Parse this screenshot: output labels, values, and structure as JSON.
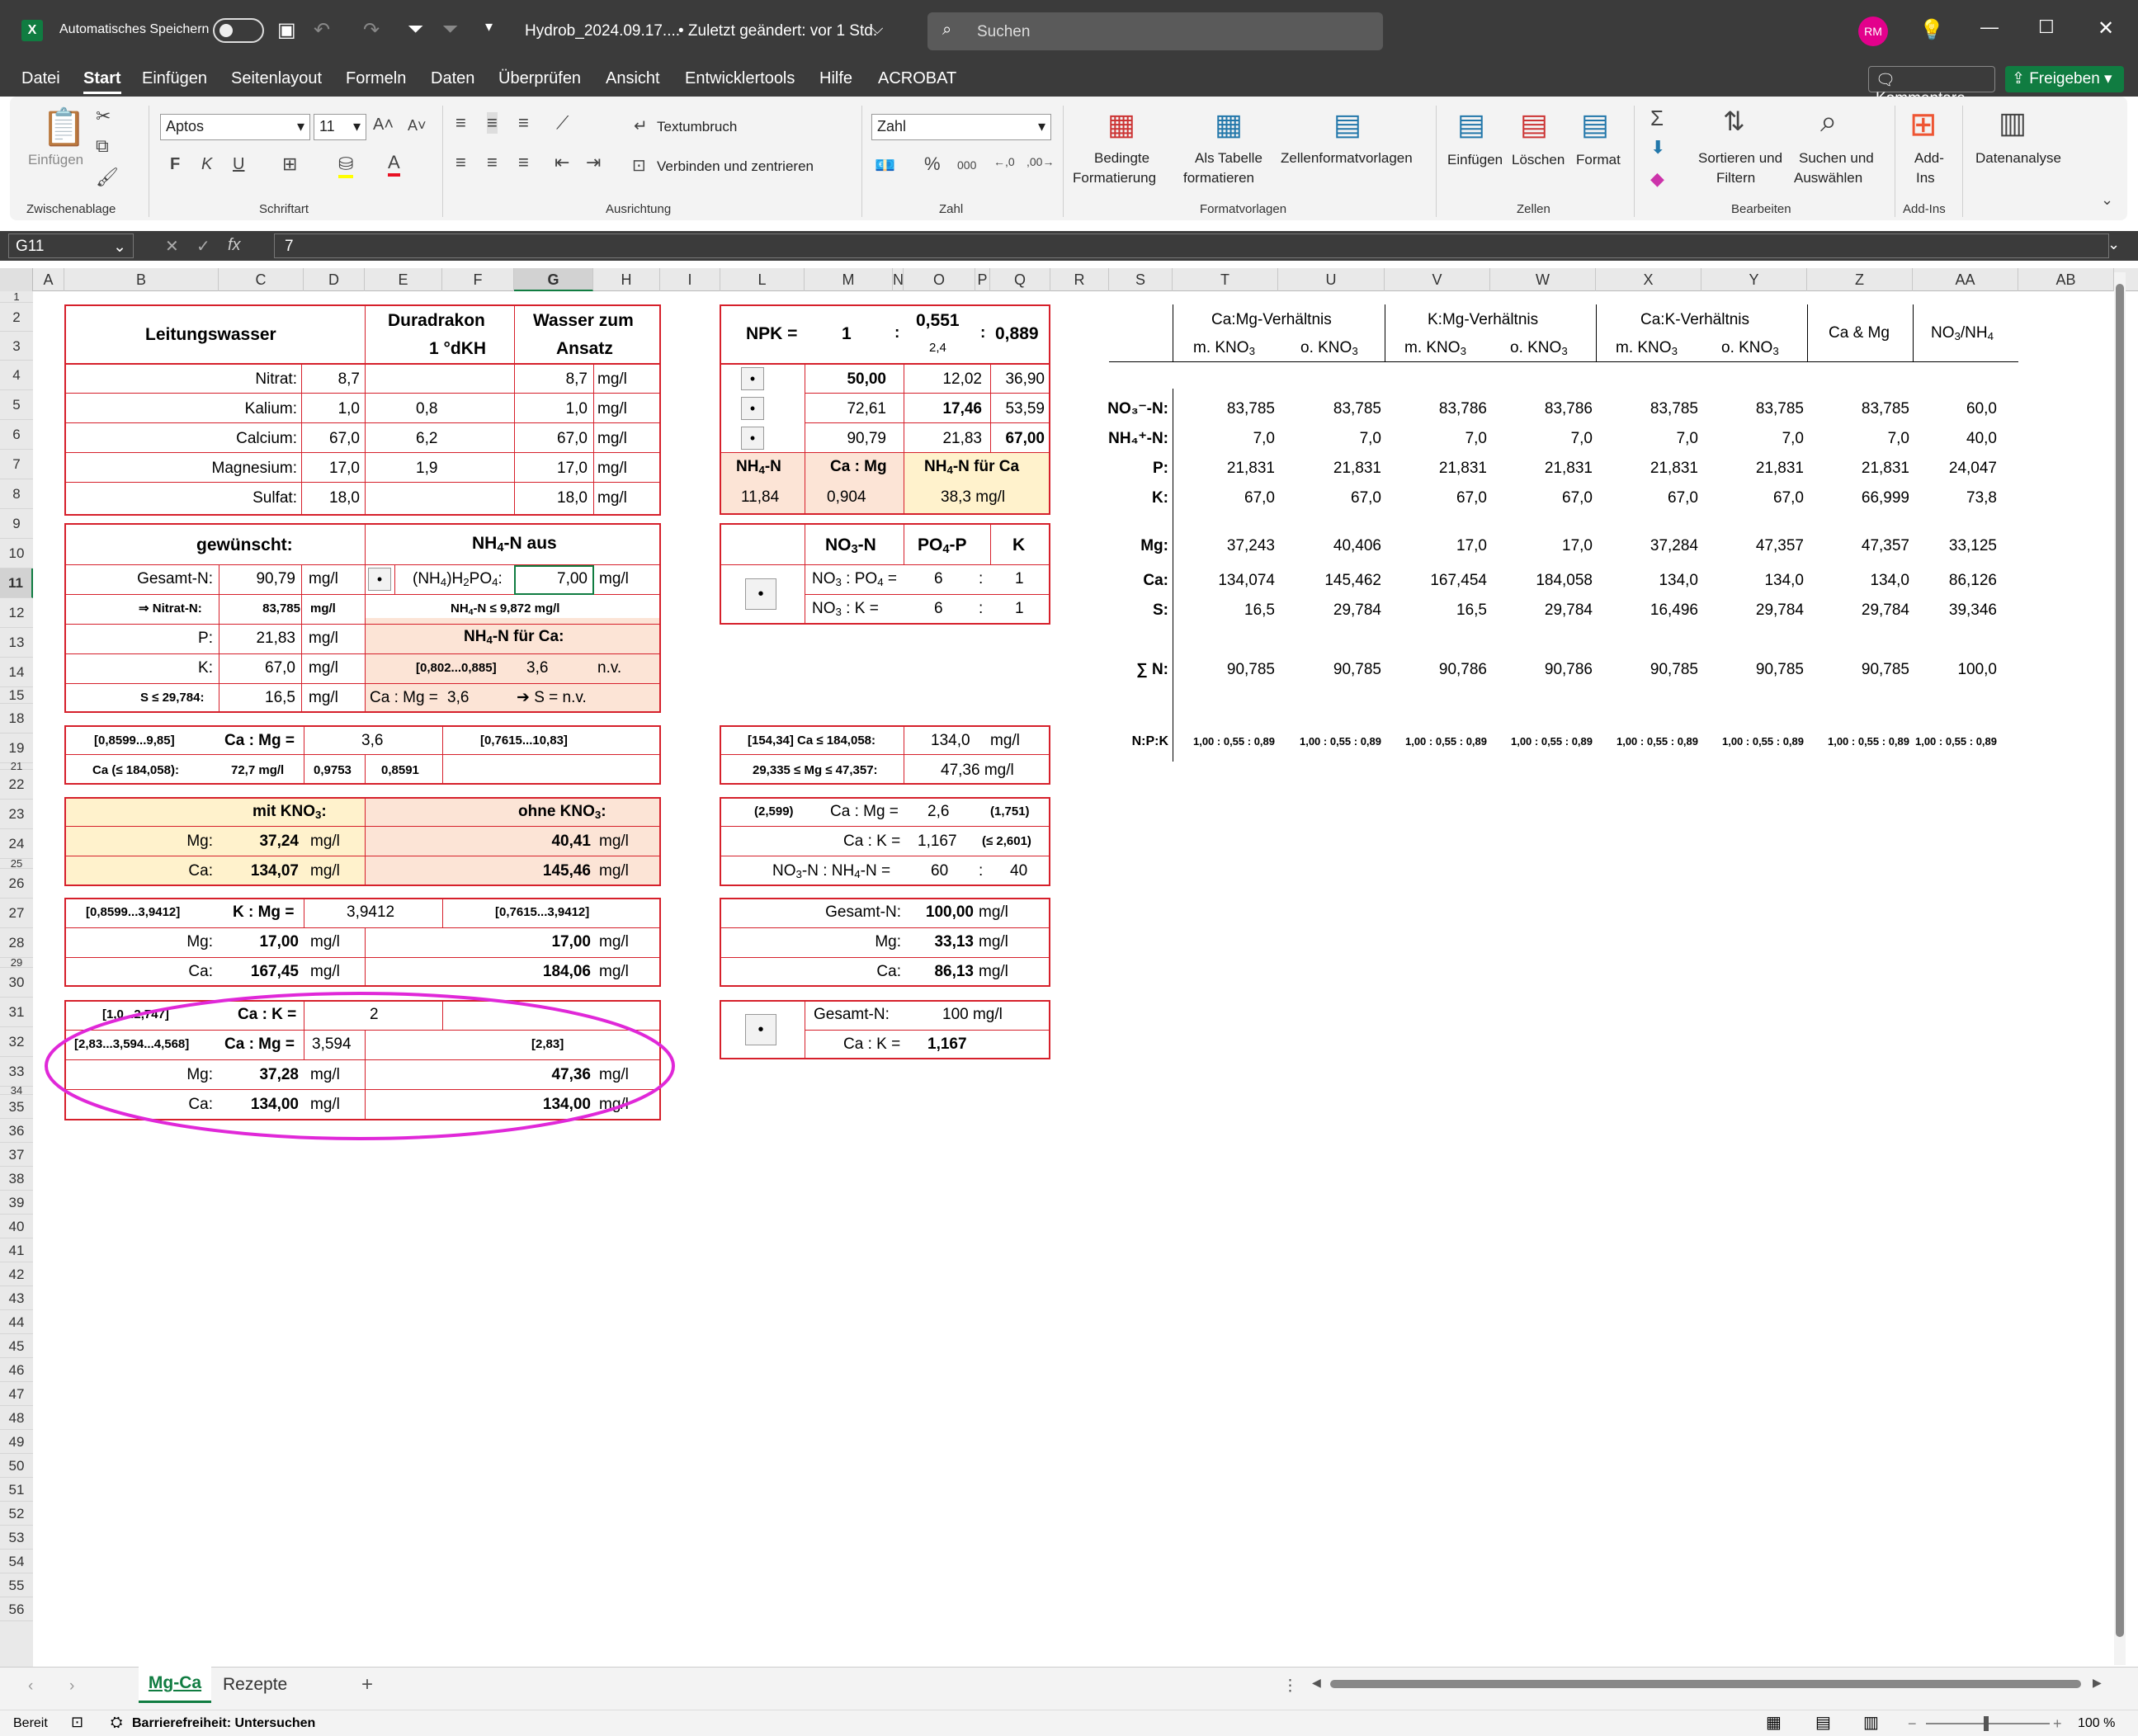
{
  "titlebar": {
    "autosave": "Automatisches Speichern",
    "filename": "Hydrob_2024.09.17....",
    "modified": "• Zuletzt geändert: vor 1 Std.",
    "search_placeholder": "Suchen",
    "user_initials": "RM"
  },
  "menu": [
    "Datei",
    "Start",
    "Einfügen",
    "Seitenlayout",
    "Formeln",
    "Daten",
    "Überprüfen",
    "Ansicht",
    "Entwicklertools",
    "Hilfe",
    "ACROBAT"
  ],
  "comments_button": "Kommentare",
  "share_button": "Freigeben",
  "ribbon": {
    "paste": "Einfügen",
    "font_name": "Aptos",
    "font_size": "11",
    "wrap_text": "Textumbruch",
    "merge_center": "Verbinden und zentrieren",
    "number_format": "Zahl",
    "conditional_1": "Bedingte",
    "conditional_2": "Formatierung",
    "as_table_1": "Als Tabelle",
    "as_table_2": "formatieren",
    "cell_styles": "Zellenformatvorlagen",
    "insert": "Einfügen",
    "delete": "Löschen",
    "format": "Format",
    "sort_1": "Sortieren und",
    "sort_2": "Filtern",
    "find_1": "Suchen und",
    "find_2": "Auswählen",
    "addins_1": "Add-",
    "addins_2": "Ins",
    "data_analysis": "Datenanalyse",
    "groups": [
      "Zwischenablage",
      "Schriftart",
      "Ausrichtung",
      "Zahl",
      "Formatvorlagen",
      "Zellen",
      "Bearbeiten",
      "Add-Ins"
    ]
  },
  "formula": {
    "name_box": "G11",
    "fx": "fx",
    "value": "7"
  },
  "columns": [
    "A",
    "B",
    "C",
    "D",
    "E",
    "F",
    "G",
    "H",
    "I",
    "L",
    "M",
    "N",
    "O",
    "P",
    "Q",
    "R",
    "S",
    "T",
    "U",
    "V",
    "W",
    "X",
    "Y",
    "Z",
    "AA",
    "AB"
  ],
  "rows": [
    "1",
    "2",
    "3",
    "4",
    "5",
    "6",
    "7",
    "8",
    "9",
    "10",
    "11",
    "12",
    "13",
    "14",
    "15",
    "18",
    "19",
    "21",
    "22",
    "23",
    "24",
    "25",
    "26",
    "27",
    "28",
    "29",
    "30",
    "31",
    "32",
    "33",
    "34",
    "35",
    "36",
    "37",
    "38",
    "39",
    "40",
    "41",
    "42",
    "43",
    "44",
    "45",
    "46",
    "47",
    "48",
    "49",
    "50",
    "51",
    "52",
    "53",
    "54",
    "55",
    "56"
  ],
  "t1": {
    "title": "Leitungswasser",
    "h2a": "Duradrakon",
    "h2b": "1  °dKH",
    "h3a": "Wasser zum",
    "h3b": "Ansatz",
    "rows": [
      {
        "l": "Nitrat:",
        "a": "8,7",
        "b": "",
        "c": "8,7",
        "u": "mg/l"
      },
      {
        "l": "Kalium:",
        "a": "1,0",
        "b": "0,8",
        "c": "1,0",
        "u": "mg/l"
      },
      {
        "l": "Calcium:",
        "a": "67,0",
        "b": "6,2",
        "c": "67,0",
        "u": "mg/l"
      },
      {
        "l": "Magnesium:",
        "a": "17,0",
        "b": "1,9",
        "c": "17,0",
        "u": "mg/l"
      },
      {
        "l": "Sulfat:",
        "a": "18,0",
        "b": "",
        "c": "18,0",
        "u": "mg/l"
      }
    ]
  },
  "t2": {
    "title": "gewünscht:",
    "nh4_title": "NH",
    "nh4_sub": "4",
    "nh4_rest": "-N aus",
    "gn_l": "Gesamt-N:",
    "gn_v": "90,79",
    "gn_u": "mg/l",
    "bullet": "•",
    "salt": "(NH",
    "salt_sub1": "4",
    ")": ")H",
    "salt_sub2": "2",
    "salt_rest": "PO",
    "salt_sub3": "4",
    ":": ":",
    "salt_v": "7,00",
    "salt_u": "mg/l",
    "nit_l": "⇒ Nitrat-N:",
    "nit_v": "83,785",
    "nit_u": "mg/l",
    "nh4n_lim": "NH",
    "nh4n_lim2": "4",
    "nh4n_lim3": "-N ≤ 9,872 mg/l",
    "p_l": "P:",
    "p_v": "21,83",
    "p_u": "mg/l",
    "nhca": "NH",
    "nhca2": "4",
    "nhca3": "-N für Ca:",
    "k_l": "K:",
    "k_v": "67,0",
    "k_u": "mg/l",
    "range": "[0,802...0,885]",
    "range_v": "3,6",
    "range_nv": "n.v.",
    "s_l": "S ≤ 29,784:",
    "s_v": "16,5",
    "s_u": "mg/l",
    "camg": "Ca : Mg =",
    "camg_v": "3,6",
    "s_nv": "➔ S = n.v."
  },
  "t3": {
    "r1a": "[0,8599...9,85]",
    "r1b": "Ca : Mg =",
    "r1c": "3,6",
    "r1d": "[0,7615...10,83]",
    "r2a": "Ca (≤ 184,058):",
    "r2b": "72,7 mg/l",
    "r2c": "0,9753",
    "r2d": "0,8591"
  },
  "t4": {
    "h1": "mit KNO",
    "h1s": "3",
    "h1e": ":",
    "h2": "ohne KNO",
    "h2s": "3",
    "h2e": ":",
    "mg_l": "Mg:",
    "mg_a": "37,24",
    "mg_b": "40,41",
    "ca_l": "Ca:",
    "ca_a": "134,07",
    "ca_b": "145,46",
    "u": "mg/l"
  },
  "t5": {
    "r1a": "[0,8599...3,9412]",
    "r1b": "K : Mg =",
    "r1c": "3,9412",
    "r1d": "[0,7615...3,9412]",
    "mg_l": "Mg:",
    "mg_a": "17,00",
    "mg_b": "17,00",
    "ca_l": "Ca:",
    "ca_a": "167,45",
    "ca_b": "184,06",
    "u": "mg/l"
  },
  "t6": {
    "r1a": "[1,0...2,747]",
    "r1b": "Ca : K =",
    "r1c": "2",
    "r2a": "[2,83...3,594...4,568]",
    "r2b": "Ca : Mg =",
    "r2c": "3,594",
    "r2d": "[2,83]",
    "mg_l": "Mg:",
    "mg_a": "37,28",
    "mg_b": "47,36",
    "ca_l": "Ca:",
    "ca_a": "134,00",
    "ca_b": "134,00",
    "u": "mg/l"
  },
  "npk": {
    "label": "NPK =",
    "n": "1",
    "colon": ":",
    "p": "0,551",
    "p_sub": "2,4",
    "k": "0,889",
    "rows": [
      [
        "50,00",
        "12,02",
        "36,90"
      ],
      [
        "72,61",
        "17,46",
        "53,59"
      ],
      [
        "90,79",
        "21,83",
        "67,00"
      ]
    ],
    "f1": "NH",
    "f1s": "4",
    "f1e": "-N",
    "f2": "Ca : Mg",
    "f3": "NH",
    "f3s": "4",
    "f3e": "-N für Ca",
    "v1": "11,84",
    "v2": "0,904",
    "v3": "38,3 mg/l"
  },
  "ratio": {
    "h1": "NO",
    "h1s": "3",
    "h1e": "-N",
    "h2": "PO",
    "h2s": "4",
    "h2e": "-P",
    "h3": "K",
    "r1": "NO",
    "r1s": "3",
    "r1e": " : PO",
    "r1s2": "4",
    "r1e2": " =",
    "r1a": "6",
    "r1b": "1",
    "r2": "NO",
    "r2s": "3",
    "r2e": " : K =",
    "r2a": "6",
    "r2b": "1"
  },
  "m18": {
    "r1a": "[154,34] Ca ≤ 184,058:",
    "r1b": "134,0",
    "r1u": "mg/l",
    "r2a": "29,335 ≤ Mg ≤ 47,357:",
    "r2b": "47,36 mg/l"
  },
  "m22": {
    "a": "(2,599)",
    "b": "Ca : Mg =",
    "c": "2,6",
    "d": "(1,751)",
    "e": "Ca : K =",
    "f": "1,167",
    "g": "(≤ 2,601)",
    "h": "NO",
    "hs": "3",
    "he": "-N : NH",
    "hs2": "4",
    "he2": "-N =",
    "i": "60",
    "j": "40"
  },
  "m26": {
    "a": "Gesamt-N:",
    "av": "100,00",
    "b": "Mg:",
    "bv": "33,13",
    "c": "Ca:",
    "cv": "86,13",
    "u": "mg/l"
  },
  "m30": {
    "a": "Gesamt-N:",
    "av": "100 mg/l",
    "b": "Ca : K =",
    "bv": "1,167"
  },
  "right": {
    "g1": "Ca:Mg-Verhältnis",
    "g2": "K:Mg-Verhältnis",
    "g3": "Ca:K-Verhältnis",
    "g4": "Ca & Mg",
    "g5": "NO",
    "g5s": "3",
    "g5e": "/NH",
    "g5s2": "4",
    "sub_m": "m. KNO",
    "sub_o": "o. KNO",
    "s3": "3",
    "labels": [
      "NO₃⁻-N:",
      "NH₄⁺-N:",
      "P:",
      "K:",
      "Mg:",
      "Ca:",
      "S:",
      "∑ N:",
      "N:P:K"
    ],
    "data": [
      [
        "83,785",
        "83,785",
        "83,786",
        "83,786",
        "83,785",
        "83,785",
        "83,785",
        "60,0"
      ],
      [
        "7,0",
        "7,0",
        "7,0",
        "7,0",
        "7,0",
        "7,0",
        "7,0",
        "40,0"
      ],
      [
        "21,831",
        "21,831",
        "21,831",
        "21,831",
        "21,831",
        "21,831",
        "21,831",
        "24,047"
      ],
      [
        "67,0",
        "67,0",
        "67,0",
        "67,0",
        "67,0",
        "67,0",
        "66,999",
        "73,8"
      ],
      [
        "37,243",
        "40,406",
        "17,0",
        "17,0",
        "37,284",
        "47,357",
        "47,357",
        "33,125"
      ],
      [
        "134,074",
        "145,462",
        "167,454",
        "184,058",
        "134,0",
        "134,0",
        "134,0",
        "86,126"
      ],
      [
        "16,5",
        "29,784",
        "16,5",
        "29,784",
        "16,496",
        "29,784",
        "29,784",
        "39,346"
      ],
      [
        "90,785",
        "90,785",
        "90,786",
        "90,786",
        "90,785",
        "90,785",
        "90,785",
        "100,0"
      ],
      [
        "1,00 : 0,55 : 0,89",
        "1,00 : 0,55 : 0,89",
        "1,00 : 0,55 : 0,89",
        "1,00 : 0,55 : 0,89",
        "1,00 : 0,55 : 0,89",
        "1,00 : 0,55 : 0,89",
        "1,00 : 0,55 : 0,89",
        "1,00 : 0,55 : 0,89"
      ]
    ]
  },
  "sheets": [
    "Mg-Ca",
    "Rezepte"
  ],
  "status": {
    "ready": "Bereit",
    "accessibility": "Barrierefreiheit: Untersuchen",
    "zoom": "100 %"
  },
  "colors": {
    "accent": "#107c41",
    "border": "#d6202b",
    "yellow": "#fff2cc",
    "peach": "#fce4d6",
    "ellipse": "#e028d8"
  }
}
